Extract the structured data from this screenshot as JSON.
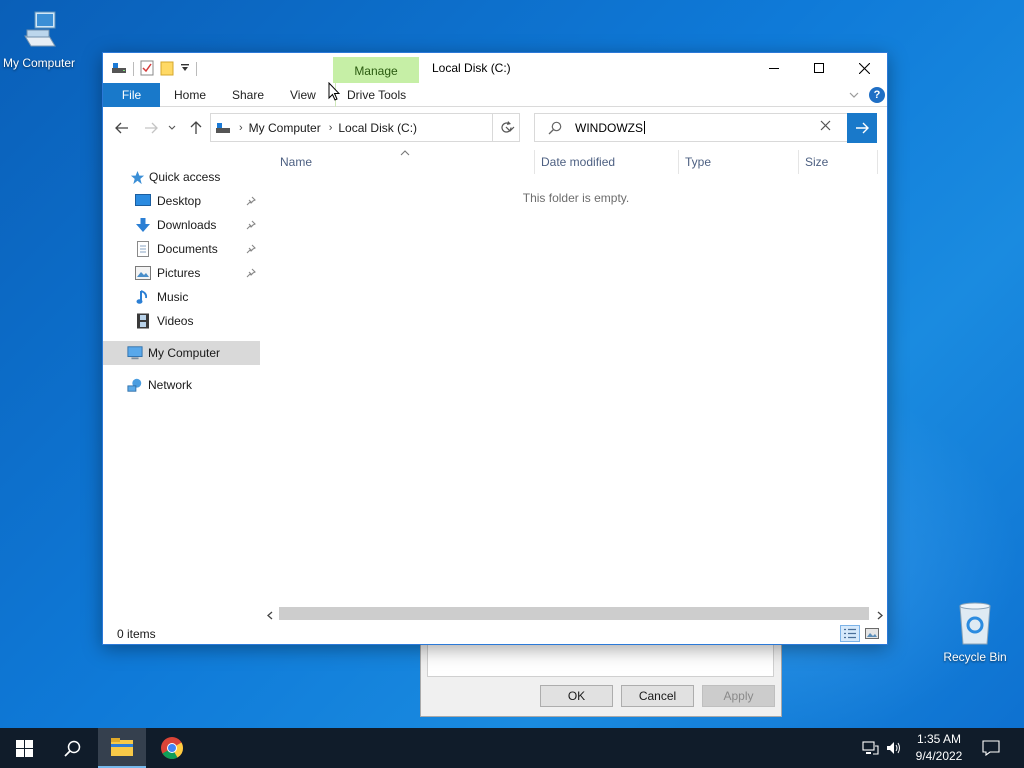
{
  "desktop": {
    "icons": [
      {
        "label": "My Computer"
      },
      {
        "label": "Recycle Bin"
      }
    ]
  },
  "explorer": {
    "title": "Local Disk (C:)",
    "context_tab": "Manage",
    "ribbon_tabs": [
      "File",
      "Home",
      "Share",
      "View",
      "Drive Tools"
    ],
    "address": {
      "crumbs": [
        "My Computer",
        "Local Disk (C:)"
      ]
    },
    "search": {
      "value": "WINDOWZS"
    },
    "nav": {
      "quick_access": "Quick access",
      "items": [
        {
          "label": "Desktop",
          "icon": "desktop-icon",
          "pinned": true
        },
        {
          "label": "Downloads",
          "icon": "download-arrow-icon",
          "pinned": true
        },
        {
          "label": "Documents",
          "icon": "documents-icon",
          "pinned": true
        },
        {
          "label": "Pictures",
          "icon": "pictures-icon",
          "pinned": true
        },
        {
          "label": "Music",
          "icon": "music-note-icon",
          "pinned": false
        },
        {
          "label": "Videos",
          "icon": "film-icon",
          "pinned": false
        }
      ],
      "my_computer": "My Computer",
      "network": "Network"
    },
    "columns": [
      "Name",
      "Date modified",
      "Type",
      "Size"
    ],
    "empty_message": "This folder is empty.",
    "status": "0 items"
  },
  "dialog": {
    "buttons": {
      "ok": "OK",
      "cancel": "Cancel",
      "apply": "Apply"
    }
  },
  "taskbar": {
    "time": "1:35 AM",
    "date": "9/4/2022"
  },
  "colors": {
    "accent": "#1979ca",
    "manage_tab": "#c6efa6",
    "taskbar": "#101c2a"
  }
}
